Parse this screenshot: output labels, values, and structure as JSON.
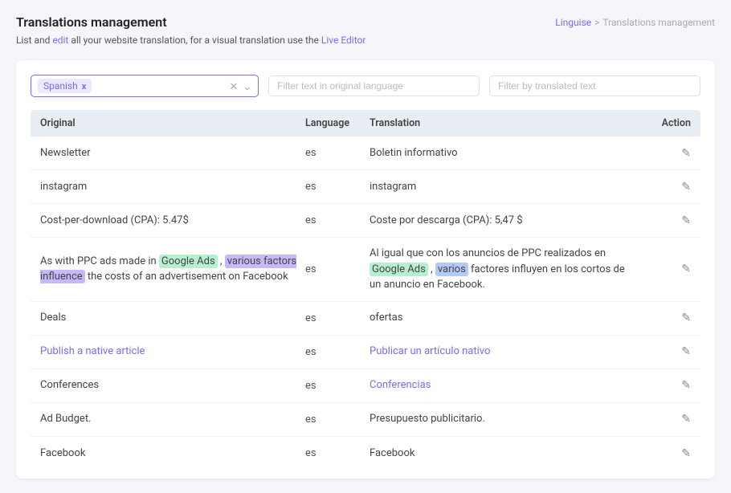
{
  "page": {
    "title": "Translations management",
    "subtitle_pre": "List and ",
    "subtitle_edit": "edit",
    "subtitle_mid": " all your website translation, for a visual translation use the ",
    "subtitle_link": "Live Editor",
    "breadcrumb": {
      "home": "Linguise",
      "separator": ">",
      "current": "Translations management"
    }
  },
  "filters": {
    "language_tag": "Spanish",
    "language_tag_remove": "x",
    "filter_original_placeholder": "Filter text in original language",
    "filter_translated_placeholder": "Filter by translated text"
  },
  "table": {
    "headers": {
      "original": "Original",
      "language": "Language",
      "translation": "Translation",
      "action": "Action"
    },
    "rows": [
      {
        "original": "Newsletter",
        "lang": "es",
        "translation": "Boletin informativo",
        "hasHighlight": false
      },
      {
        "original": "instagram",
        "lang": "es",
        "translation": "instagram",
        "hasHighlight": false
      },
      {
        "original": "Cost-per-download (CPA): 5.47$",
        "lang": "es",
        "translation": "Coste por descarga (CPA): 5,47 $",
        "hasHighlight": false
      },
      {
        "original_html": true,
        "lang": "es",
        "translation_html": true,
        "hasHighlight": true
      },
      {
        "original": "Deals",
        "lang": "es",
        "translation": "ofertas",
        "hasHighlight": false
      },
      {
        "original": "Publish a native article",
        "lang": "es",
        "translation": "Publicar un artículo nativo",
        "hasHighlight": false,
        "original_link": true,
        "translation_link": true
      },
      {
        "original": "Conferences",
        "lang": "es",
        "translation": "Conferencias",
        "hasHighlight": false,
        "translation_link": true
      },
      {
        "original": "Ad Budget.",
        "lang": "es",
        "translation": "Presupuesto publicitario.",
        "hasHighlight": false
      },
      {
        "original": "Facebook",
        "lang": "es",
        "translation": "Facebook",
        "hasHighlight": false
      }
    ]
  }
}
